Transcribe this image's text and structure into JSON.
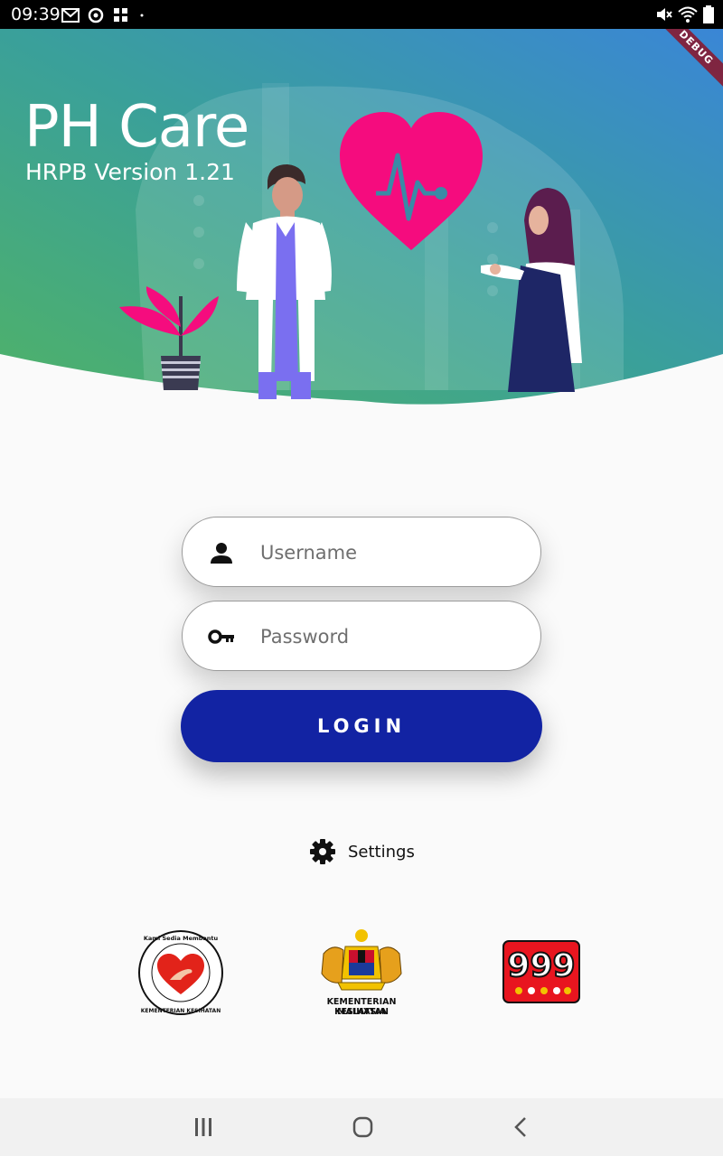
{
  "status_bar": {
    "time": "09:39",
    "left_icons": [
      "gmail-icon",
      "sync-icon",
      "grid-icon",
      "dot-icon"
    ],
    "right_icons": [
      "mute-icon",
      "wifi-icon",
      "battery-icon"
    ]
  },
  "debug_banner": "DEBUG",
  "hero": {
    "title": "PH Care",
    "version": "HRPB Version 1.21",
    "gradient": [
      "#52b46a",
      "#3a8ad3"
    ]
  },
  "login_form": {
    "username_placeholder": "Username",
    "username_value": "",
    "password_placeholder": "Password",
    "password_value": "",
    "login_label": "LOGIN",
    "login_color": "#1223a3"
  },
  "settings": {
    "label": "Settings",
    "icon": "gear-icon"
  },
  "logos": {
    "heart_logo_text": "Kami Sedia Membantu KEMENTERIAN KESIHATAN MALAYSIA",
    "moh_caption_line1": "KEMENTERIAN KESIHATAN",
    "moh_caption_line2": "MALAYSIA",
    "emergency_number": "999"
  },
  "nav_bar": {
    "icons": [
      "recents-icon",
      "home-icon",
      "back-icon"
    ]
  }
}
